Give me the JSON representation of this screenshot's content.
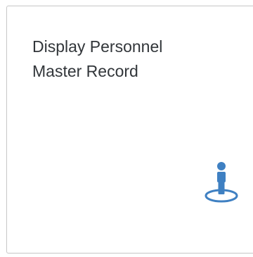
{
  "tile": {
    "title_line1": "Display Personnel",
    "title_line2": "Master Record",
    "icon": "person-placeholder-icon",
    "icon_color": "#3f80c2"
  }
}
